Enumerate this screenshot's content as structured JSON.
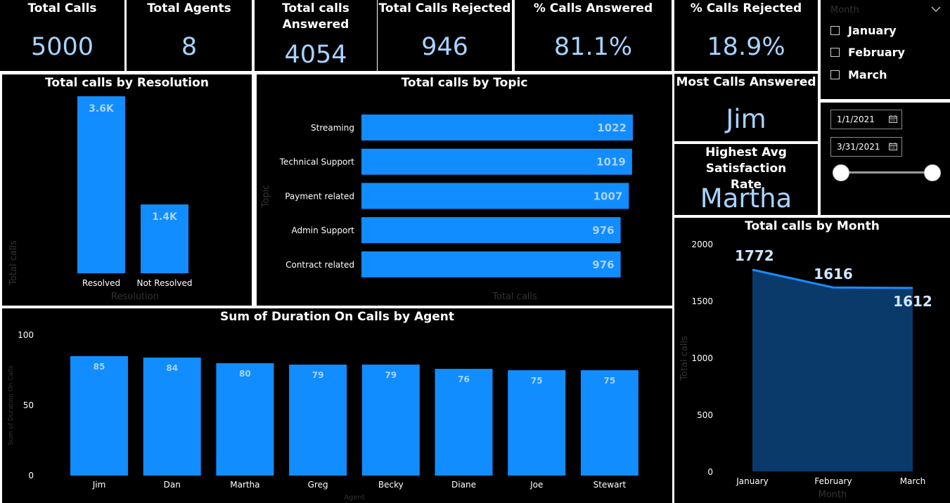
{
  "kpis": {
    "total_calls": {
      "label": "Total Calls",
      "value": "5000"
    },
    "total_agents": {
      "label": "Total Agents",
      "value": "8"
    },
    "total_answered": {
      "label": "Total calls Answered",
      "value": "4054"
    },
    "total_rejected": {
      "label": "Total Calls Rejected",
      "value": "946"
    },
    "pct_answered": {
      "label": "% Calls Answered",
      "value": "81.1%"
    },
    "pct_rejected": {
      "label": "% Calls Rejected",
      "value": "18.9%"
    },
    "most_answered": {
      "label": "Most Calls Answered",
      "value": "Jim"
    },
    "highest_satisfaction": {
      "label": "Highest Avg Satisfaction Rate",
      "value": "Martha"
    }
  },
  "month_slicer": {
    "title": "Month",
    "options": [
      {
        "label": "January",
        "checked": false
      },
      {
        "label": "February",
        "checked": false
      },
      {
        "label": "March",
        "checked": false
      }
    ]
  },
  "date_slicer": {
    "start": "1/1/2021",
    "end": "3/31/2021",
    "range_fraction": [
      0,
      1
    ]
  },
  "colors": {
    "bar": "#118dff",
    "area_fill": "#0a3a6a",
    "area_line": "#1a8cff",
    "value_label": "#a8d3ff",
    "axis_title": "#333333"
  },
  "chart_data": [
    {
      "id": "resolution",
      "type": "bar",
      "title": "Total calls by Resolution",
      "categories": [
        "Resolved",
        "Not Resolved"
      ],
      "values": [
        3600,
        1400
      ],
      "value_labels": [
        "3.6K",
        "1.4K"
      ],
      "xlabel": "Resolution",
      "ylabel": "Total calls",
      "ylim": [
        0,
        4000
      ]
    },
    {
      "id": "topic",
      "type": "bar",
      "orientation": "horizontal",
      "title": "Total calls by Topic",
      "categories": [
        "Streaming",
        "Technical Support",
        "Payment related",
        "Admin Support",
        "Contract related"
      ],
      "values": [
        1022,
        1019,
        1007,
        976,
        976
      ],
      "xlabel": "Total calls",
      "ylabel": "Topic",
      "xlim": [
        0,
        1022
      ]
    },
    {
      "id": "duration",
      "type": "bar",
      "title": "Sum of Duration On Calls by Agent",
      "categories": [
        "Jim",
        "Dan",
        "Martha",
        "Greg",
        "Becky",
        "Diane",
        "Joe",
        "Stewart"
      ],
      "values": [
        85,
        84,
        80,
        79,
        79,
        76,
        75,
        75
      ],
      "xlabel": "Agent",
      "ylabel": "Sum of Duration On Calls",
      "yticks": [
        "100",
        "50",
        "0"
      ],
      "ylim": [
        0,
        100
      ]
    },
    {
      "id": "month",
      "type": "area",
      "title": "Total calls by Month",
      "categories": [
        "January",
        "February",
        "March"
      ],
      "values": [
        1772,
        1616,
        1612
      ],
      "xlabel": "Month",
      "ylabel": "Total calls",
      "yticks": [
        "2000",
        "1500",
        "1000",
        "500",
        "0"
      ],
      "ylim": [
        0,
        2000
      ]
    }
  ]
}
